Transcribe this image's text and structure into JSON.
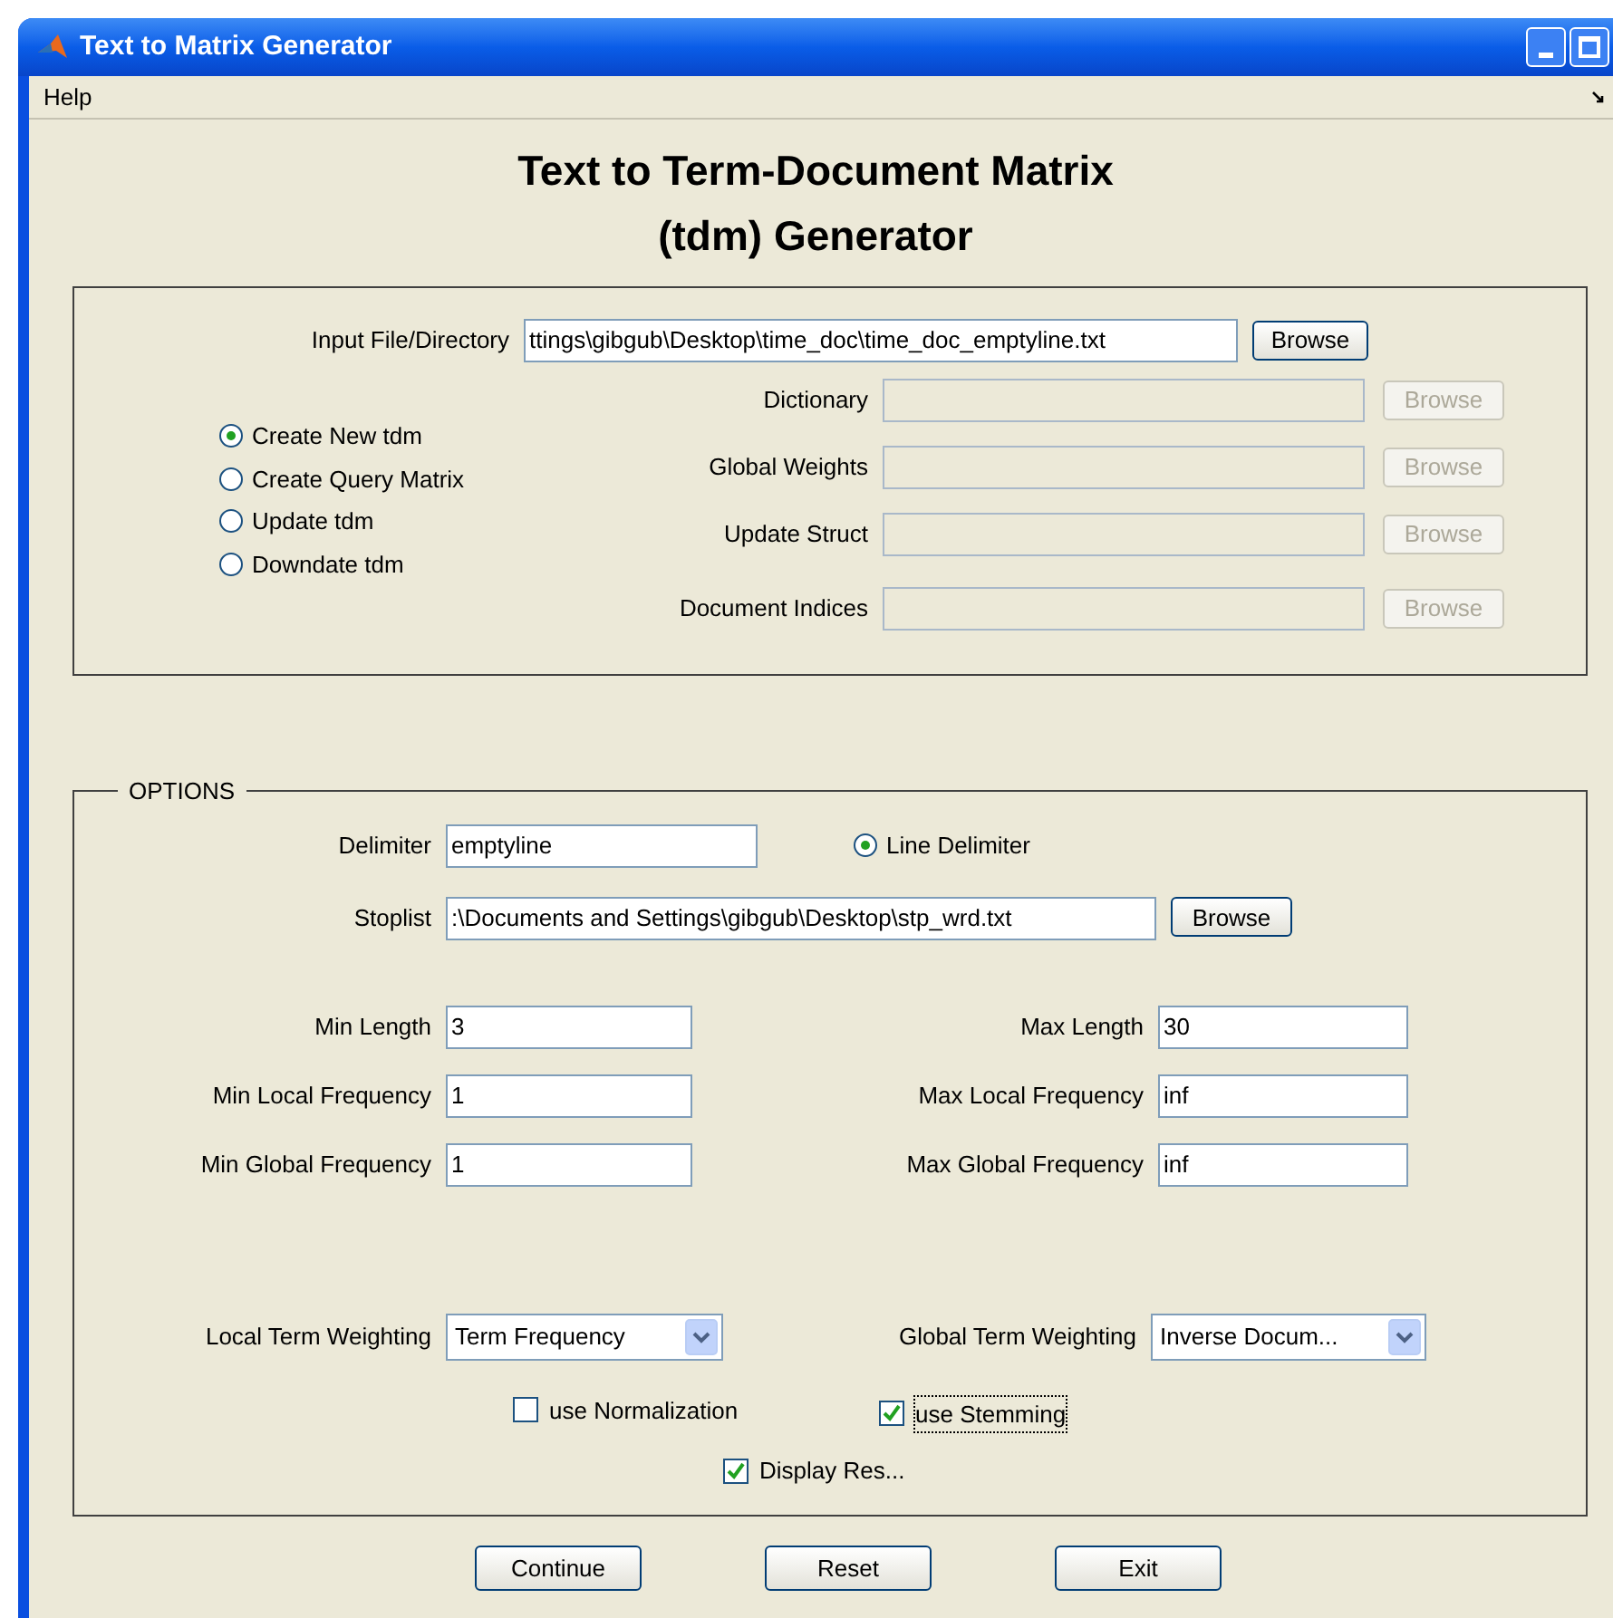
{
  "window": {
    "title": "Text to Matrix Generator"
  },
  "menu": [
    {
      "label": "Help"
    }
  ],
  "heading": [
    "Text to Term-Document Matrix",
    "(tdm) Generator"
  ],
  "input": {
    "label": "Input File/Directory",
    "value": "ttings\\gibgub\\Desktop\\time_doc\\time_doc_emptyline.txt",
    "button": "Browse"
  },
  "modes": [
    {
      "label": "Create New tdm",
      "selected": true
    },
    {
      "label": "Create Query Matrix",
      "selected": false
    },
    {
      "label": "Update tdm",
      "selected": false
    },
    {
      "label": "Downdate tdm",
      "selected": false
    }
  ],
  "files": [
    {
      "label": "Dictionary",
      "button": "Browse",
      "disabled": true
    },
    {
      "label": "Global Weights",
      "button": "Browse",
      "disabled": true
    },
    {
      "label": "Update Struct",
      "button": "Browse",
      "disabled": true
    },
    {
      "label": "Document Indices",
      "button": "Browse",
      "disabled": true
    }
  ],
  "options": {
    "title": "OPTIONS",
    "delimiter": {
      "label": "Delimiter",
      "value": "emptyline"
    },
    "line_delimiter": {
      "label": "Line Delimiter",
      "selected": true
    },
    "stoplist": {
      "label": "Stoplist",
      "value": ":\\Documents and Settings\\gibgub\\Desktop\\stp_wrd.txt",
      "button": "Browse"
    },
    "limits": [
      {
        "label": "Min Length",
        "value": "3"
      },
      {
        "label": "Max Length",
        "value": "30"
      },
      {
        "label": "Min Local Frequency",
        "value": "1"
      },
      {
        "label": "Max Local Frequency",
        "value": "inf"
      },
      {
        "label": "Min Global Frequency",
        "value": "1"
      },
      {
        "label": "Max Global Frequency",
        "value": "inf"
      }
    ],
    "weighting": [
      {
        "label": "Local Term Weighting",
        "value": "Term Frequency"
      },
      {
        "label": "Global Term Weighting",
        "value": "Inverse Docum..."
      }
    ],
    "checkboxes": [
      {
        "label": "use Normalization",
        "checked": false,
        "focused": false
      },
      {
        "label": "use Stemming",
        "checked": true,
        "focused": true
      },
      {
        "label": "Display Res...",
        "checked": true,
        "focused": false
      }
    ]
  },
  "buttons": [
    "Continue",
    "Reset",
    "Exit"
  ]
}
